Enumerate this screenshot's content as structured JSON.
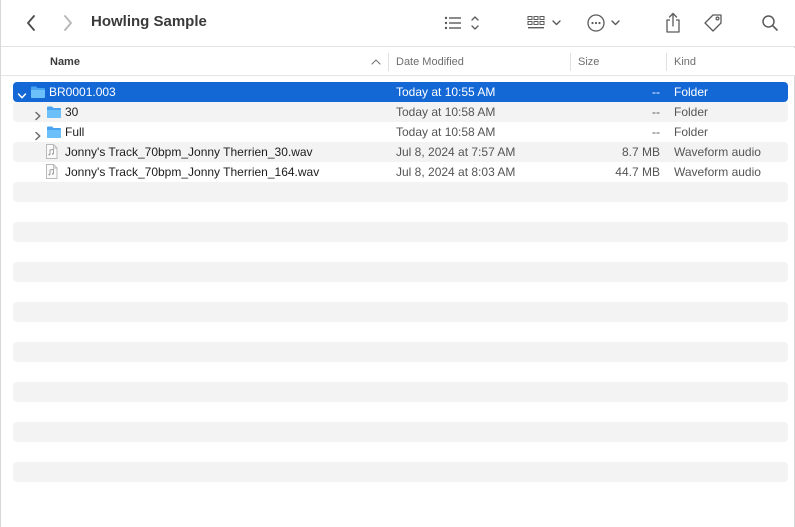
{
  "window": {
    "title": "Howling Sample"
  },
  "toolbar": {
    "back": "chevron-left-icon",
    "forward": "chevron-right-icon",
    "view_list": "list-view-icon",
    "group": "grid-group-icon",
    "action": "ellipsis-circle-icon",
    "share": "share-icon",
    "tag": "tag-icon",
    "search": "search-icon"
  },
  "columns": {
    "name": "Name",
    "date": "Date Modified",
    "size": "Size",
    "kind": "Kind"
  },
  "files": [
    {
      "name": "BR0001.003",
      "date": "Today at 10:55 AM",
      "size": "--",
      "kind": "Folder",
      "type": "folder",
      "level": 0,
      "expanded": true,
      "selected": true
    },
    {
      "name": "30",
      "date": "Today at 10:58 AM",
      "size": "--",
      "kind": "Folder",
      "type": "folder",
      "level": 1,
      "expanded": false,
      "selected": false
    },
    {
      "name": "Full",
      "date": "Today at 10:58 AM",
      "size": "--",
      "kind": "Folder",
      "type": "folder",
      "level": 1,
      "expanded": false,
      "selected": false
    },
    {
      "name": "Jonny's Track_70bpm_Jonny Therrien_30.wav",
      "date": "Jul 8, 2024 at 7:57 AM",
      "size": "8.7 MB",
      "kind": "Waveform audio",
      "type": "audio",
      "level": 1,
      "selected": false
    },
    {
      "name": "Jonny's Track_70bpm_Jonny Therrien_164.wav",
      "date": "Jul 8, 2024 at 8:03 AM",
      "size": "44.7 MB",
      "kind": "Waveform audio",
      "type": "audio",
      "level": 1,
      "selected": false
    }
  ],
  "colors": {
    "selection": "#1468d6",
    "folder": "#4aa3ee",
    "stripe": "#f3f3f3"
  }
}
